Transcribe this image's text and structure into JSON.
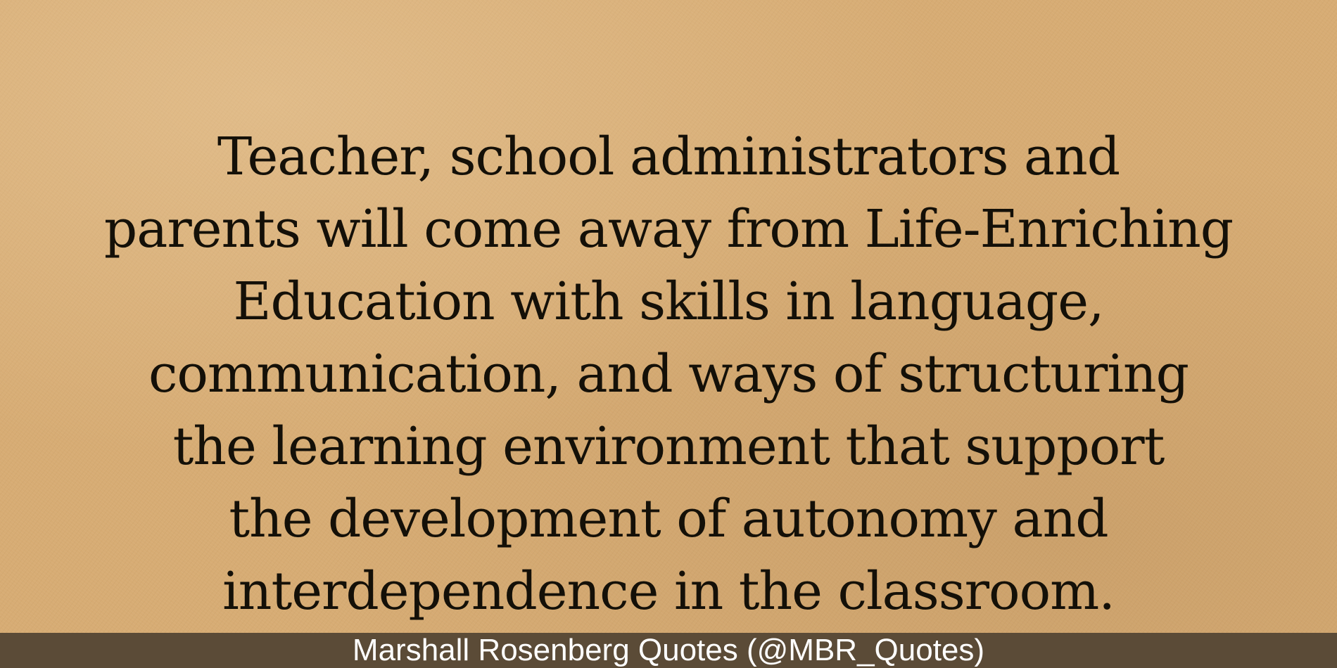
{
  "quote": {
    "lines": [
      "Teacher, school administrators and",
      "parents will come away from Life-Enriching",
      "Education with skills in language,",
      "communication, and ways of structuring",
      "the learning environment that support",
      "the development of autonomy and",
      "interdependence in the classroom."
    ]
  },
  "footer": {
    "attribution": "Marshall Rosenberg Quotes (@MBR_Quotes)"
  },
  "colors": {
    "paper": "#d7ac74",
    "text": "#141008",
    "footer_bar": "#5b4b37",
    "footer_text": "#ffffff"
  }
}
